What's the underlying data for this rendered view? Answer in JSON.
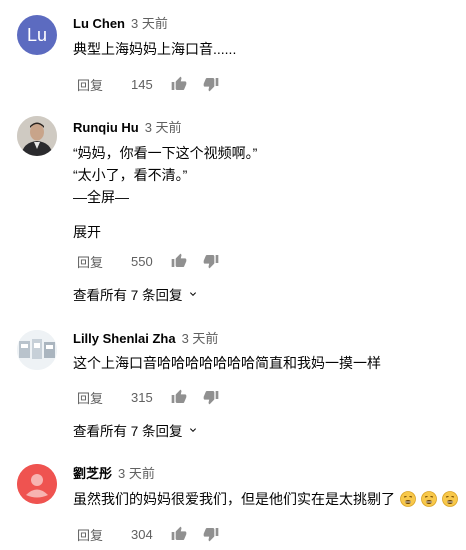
{
  "comments": [
    {
      "author": "Lu Chen",
      "time": "3 天前",
      "avatar_letters": "Lu",
      "avatar_color": "#5c6bc0",
      "lines": [
        "典型上海妈妈上海口音......"
      ],
      "reply_label": "回复",
      "likes": "145"
    },
    {
      "author": "Runqiu Hu",
      "time": "3 天前",
      "lines": [
        "“妈妈，你看一下这个视频啊。”",
        "“太小了，看不清。”",
        "—全屏—"
      ],
      "expand_label": "展开",
      "reply_label": "回复",
      "likes": "550",
      "view_replies": "查看所有 7 条回复"
    },
    {
      "author": "Lilly Shenlai Zha",
      "time": "3 天前",
      "lines": [
        "这个上海口音哈哈哈哈哈哈哈简直和我妈一摸一样"
      ],
      "reply_label": "回复",
      "likes": "315",
      "view_replies": "查看所有 7 条回复"
    },
    {
      "author": "劉芝彤",
      "time": "3 天前",
      "avatar_color": "#ef5350",
      "lines": [
        "虽然我们的妈妈很爱我们，但是他们实在是太挑剔了"
      ],
      "emojis": [
        "weary-face-emoji",
        "weary-face-emoji",
        "weary-face-emoji"
      ],
      "reply_label": "回复",
      "likes": "304"
    }
  ],
  "icons": {
    "like": "thumbs-up-icon",
    "dislike": "thumbs-down-icon",
    "expand_replies": "chevron-down-icon"
  }
}
